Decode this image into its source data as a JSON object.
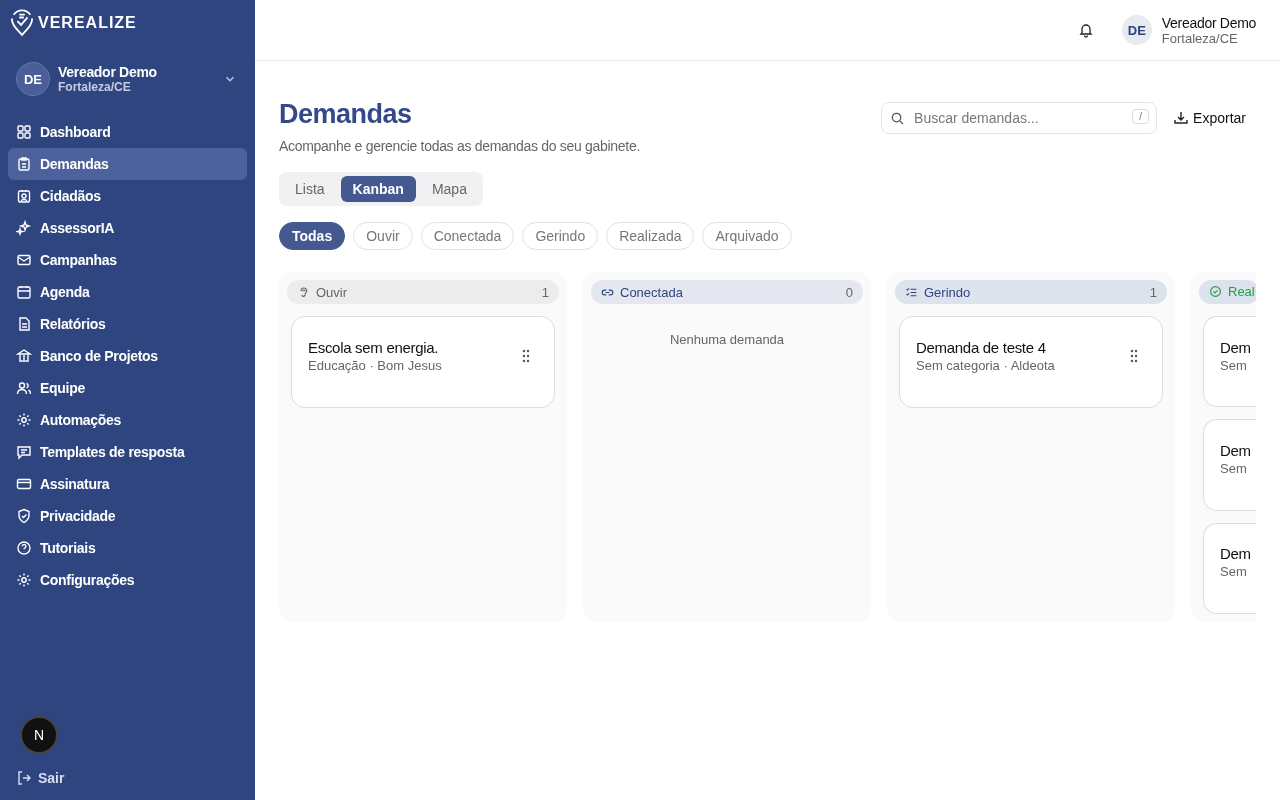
{
  "brand": "VEREALIZE",
  "sidebar": {
    "user": {
      "initials": "DE",
      "name": "Vereador Demo",
      "location": "Fortaleza/CE"
    },
    "items": [
      {
        "label": "Dashboard",
        "selected": false
      },
      {
        "label": "Demandas",
        "selected": true
      },
      {
        "label": "Cidadãos",
        "selected": false
      },
      {
        "label": "AssessorIA",
        "selected": false
      },
      {
        "label": "Campanhas",
        "selected": false
      },
      {
        "label": "Agenda",
        "selected": false
      },
      {
        "label": "Relatórios",
        "selected": false
      },
      {
        "label": "Banco de Projetos",
        "selected": false
      },
      {
        "label": "Equipe",
        "selected": false
      },
      {
        "label": "Automações",
        "selected": false
      },
      {
        "label": "Templates de resposta",
        "selected": false
      },
      {
        "label": "Assinatura",
        "selected": false
      },
      {
        "label": "Privacidade",
        "selected": false
      },
      {
        "label": "Tutoriais",
        "selected": false
      },
      {
        "label": "Configurações",
        "selected": false
      }
    ],
    "logout": "Sair",
    "dev_badge": "N"
  },
  "header": {
    "initials": "DE",
    "name": "Vereador Demo",
    "location": "Fortaleza/CE"
  },
  "page": {
    "title": "Demandas",
    "subtitle": "Acompanhe e gerencie todas as demandas do seu gabinete.",
    "search": {
      "placeholder": "Buscar demandas...",
      "shortcut": "/"
    },
    "export": "Exportar"
  },
  "views": [
    {
      "label": "Lista",
      "selected": false
    },
    {
      "label": "Kanban",
      "selected": true
    },
    {
      "label": "Mapa",
      "selected": false
    }
  ],
  "filters": [
    {
      "label": "Todas",
      "selected": true
    },
    {
      "label": "Ouvir",
      "selected": false
    },
    {
      "label": "Conectada",
      "selected": false
    },
    {
      "label": "Gerindo",
      "selected": false
    },
    {
      "label": "Realizada",
      "selected": false
    },
    {
      "label": "Arquivado",
      "selected": false
    }
  ],
  "columns": [
    {
      "title": "Ouvir",
      "count": "1",
      "color": "#666666",
      "cards": [
        {
          "title": "Escola sem energia.",
          "meta": "Educação · Bom Jesus"
        }
      ]
    },
    {
      "title": "Conectada",
      "count": "0",
      "color": "#2f4580",
      "empty": "Nenhuma demanda"
    },
    {
      "title": "Gerindo",
      "count": "1",
      "color": "#2f4580",
      "cards": [
        {
          "title": "Demanda de teste 4",
          "meta": "Sem categoria · Aldeota"
        }
      ]
    },
    {
      "title": "Real",
      "color": "#22a046",
      "cards": [
        {
          "title": "Dem",
          "meta": "Sem"
        },
        {
          "title": "Dem",
          "meta": "Sem"
        },
        {
          "title": "Dem",
          "meta": "Sem"
        }
      ]
    }
  ]
}
